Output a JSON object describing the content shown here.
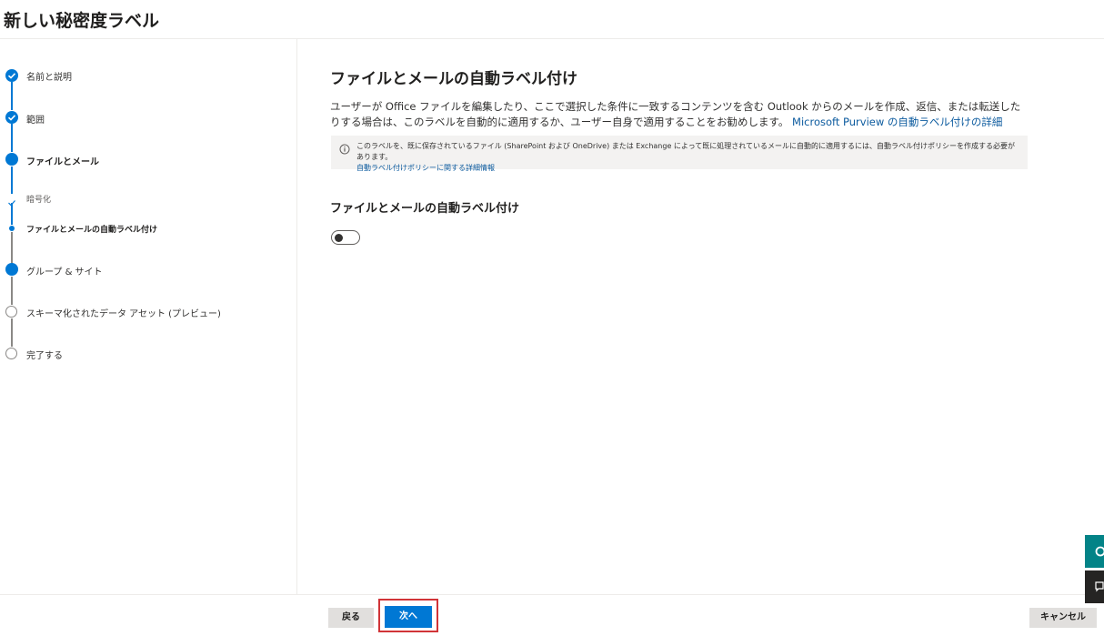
{
  "page": {
    "title": "新しい秘密度ラベル"
  },
  "steps": [
    {
      "label": "名前と説明",
      "state": "completed"
    },
    {
      "label": "範囲",
      "state": "completed"
    },
    {
      "label": "ファイルとメール",
      "state": "current"
    },
    {
      "label": "暗号化",
      "state": "completed-substep"
    },
    {
      "label": "ファイルとメールの自動ラベル付け",
      "state": "current-substep"
    },
    {
      "label": "グループ & サイト",
      "state": "upcoming-active"
    },
    {
      "label": "スキーマ化されたデータ アセット (プレビュー)",
      "state": "not-started"
    },
    {
      "label": "完了する",
      "state": "not-started"
    }
  ],
  "content": {
    "title": "ファイルとメールの自動ラベル付け",
    "description": "ユーザーが Office ファイルを編集したり、ここで選択した条件に一致するコンテンツを含む Outlook からのメールを作成、返信、または転送したりする場合は、このラベルを自動的に適用するか、ユーザー自身で適用することをお勧めします。",
    "description_link": "Microsoft Purview の自動ラベル付けの詳細",
    "info_text": "このラベルを、既に保存されているファイル (SharePoint および OneDrive) または Exchange によって既に処理されているメールに自動的に適用するには、自動ラベル付けポリシーを作成する必要があります。",
    "info_link": "自動ラベル付けポリシーに関する詳細情報",
    "section_title": "ファイルとメールの自動ラベル付け",
    "toggle_state": "off"
  },
  "footer": {
    "back_label": "戻る",
    "next_label": "次へ",
    "cancel_label": "キャンセル"
  },
  "colors": {
    "accent": "#0078d4",
    "highlight": "#d13438",
    "teal_tab": "#038387"
  },
  "icons": {
    "completed": "checkmark-circle-icon",
    "info": "info-icon",
    "side_tab_1": "help-icon",
    "side_tab_2": "feedback-icon"
  }
}
